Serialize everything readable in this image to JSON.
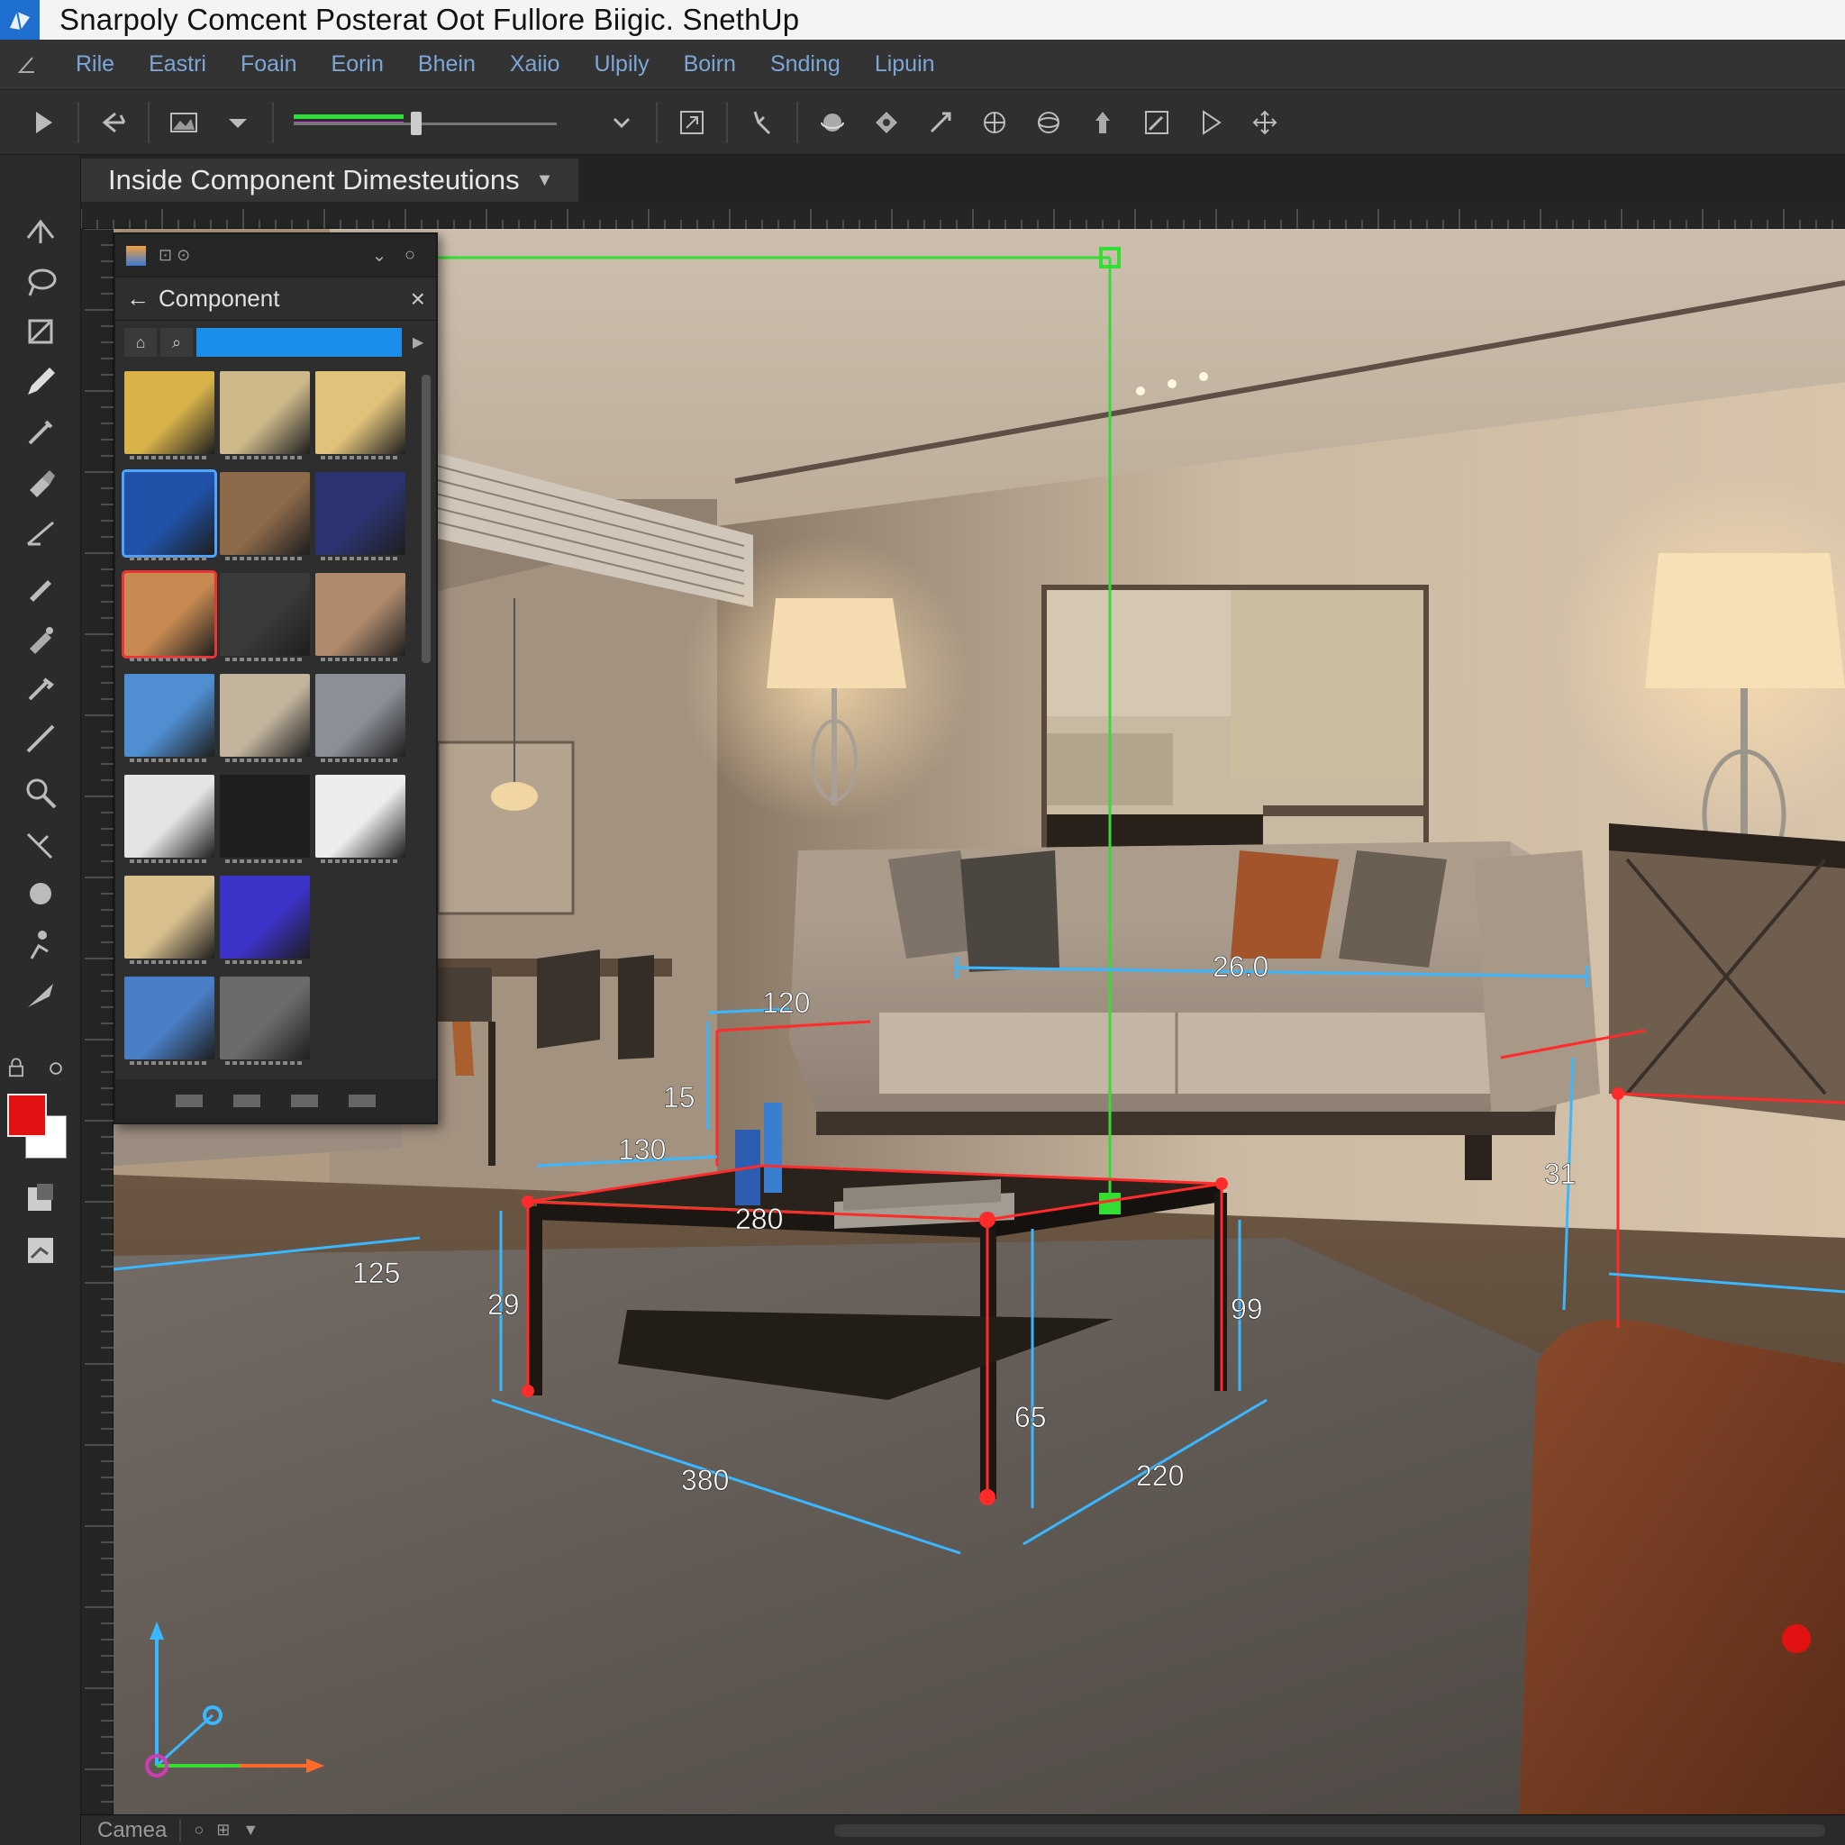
{
  "window": {
    "title": "Snarpoly Comcent Posterat Oot Fullore  Biigic. SnethUp"
  },
  "menu": {
    "items": [
      "Rile",
      "Eastri",
      "Foain",
      "Eorin",
      "Bhein",
      "Xaiio",
      "Ulpily",
      "Boirn",
      "Snding",
      "Lipuin"
    ]
  },
  "toolbar": {
    "buttons": [
      "select-icon",
      "undo-arrow-icon",
      "image-icon",
      "dropdown-caret-icon",
      "layer-slider",
      "export-icon",
      "pin-tool-icon",
      "orbit-icon",
      "rotate-icon",
      "pan-icon",
      "globe-icon",
      "sphere-icon",
      "push-pull-icon",
      "scale-icon",
      "play-icon",
      "move-icon"
    ]
  },
  "document": {
    "tab_label": "Inside  Component Dimesteutions"
  },
  "panel": {
    "title": "Component",
    "close": "×",
    "back": "←",
    "search_placeholder": "",
    "thumbnails": [
      {
        "row": 0,
        "col": 0,
        "color": "#d9b34a"
      },
      {
        "row": 0,
        "col": 1,
        "color": "#cdb98a"
      },
      {
        "row": 0,
        "col": 2,
        "color": "#e1c27a"
      },
      {
        "row": 1,
        "col": 0,
        "color": "#1f52a8",
        "selected": "blue"
      },
      {
        "row": 1,
        "col": 1,
        "color": "#8c6a4a"
      },
      {
        "row": 1,
        "col": 2,
        "color": "#2b3470"
      },
      {
        "row": 2,
        "col": 0,
        "color": "#c98a52",
        "selected": "red"
      },
      {
        "row": 2,
        "col": 1,
        "color": "#3a3a3a"
      },
      {
        "row": 2,
        "col": 2,
        "color": "#b18a6d"
      },
      {
        "row": 3,
        "col": 0,
        "color": "#4f8ed1"
      },
      {
        "row": 3,
        "col": 1,
        "color": "#c3b49e"
      },
      {
        "row": 3,
        "col": 2,
        "color": "#8b8f97"
      },
      {
        "row": 4,
        "col": 0,
        "color": "#e4e4e4"
      },
      {
        "row": 4,
        "col": 1,
        "color": "#1e1e1e"
      },
      {
        "row": 4,
        "col": 2,
        "color": "#ececec"
      },
      {
        "row": 5,
        "col": 0,
        "color": "#d8bf8e"
      },
      {
        "row": 5,
        "col": 1,
        "color": "#3c33c9"
      },
      {
        "row": 6,
        "col": 0,
        "color": "#4a7fc8"
      },
      {
        "row": 6,
        "col": 1,
        "color": "#6a6a6a"
      }
    ]
  },
  "colors": {
    "foreground": "#e31212",
    "background": "#ffffff",
    "guide_green": "#33dd33",
    "dim_blue": "#39b7ff",
    "edge_red": "#ff2a2a"
  },
  "dimensions": {
    "sofa_width": "26.0",
    "sofa_depth": "120",
    "sofa_height": "15",
    "left_depth": "130",
    "table_top": "280",
    "chair_width": "125",
    "table_height": "29",
    "right_height": "99",
    "table_length": "380",
    "leg_height": "65",
    "table_depth": "220",
    "side_table": "31"
  },
  "status": {
    "camera_label": "Camea"
  }
}
